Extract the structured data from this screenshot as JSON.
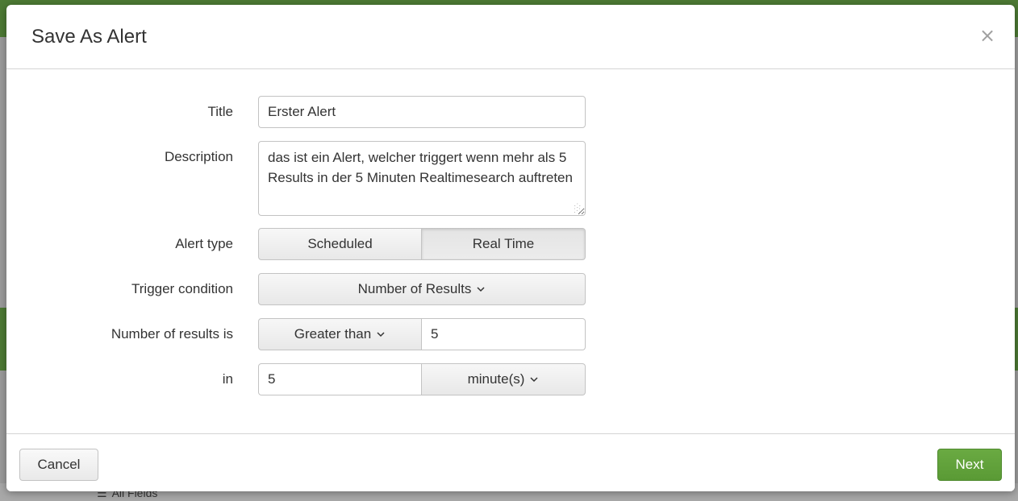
{
  "background": {
    "all_fields_tab": "All Fields"
  },
  "modal": {
    "title": "Save As Alert",
    "close_glyph": "×"
  },
  "form": {
    "title_label": "Title",
    "title_value": "Erster Alert",
    "description_label": "Description",
    "description_value": "das ist ein Alert, welcher triggert wenn mehr als 5 Results in der 5 Minuten Realtimesearch auftreten",
    "alert_type_label": "Alert type",
    "alert_type_options": [
      "Scheduled",
      "Real Time"
    ],
    "alert_type_selected": "Real Time",
    "trigger_condition_label": "Trigger condition",
    "trigger_condition_value": "Number of Results",
    "number_of_results_label": "Number of results is",
    "comparison_value": "Greater than",
    "threshold_value": "5",
    "in_label": "in",
    "window_value": "5",
    "window_unit": "minute(s)"
  },
  "footer": {
    "cancel_label": "Cancel",
    "next_label": "Next"
  },
  "colors": {
    "primary_green": "#5a9a35",
    "header_green": "#4d7a34"
  }
}
